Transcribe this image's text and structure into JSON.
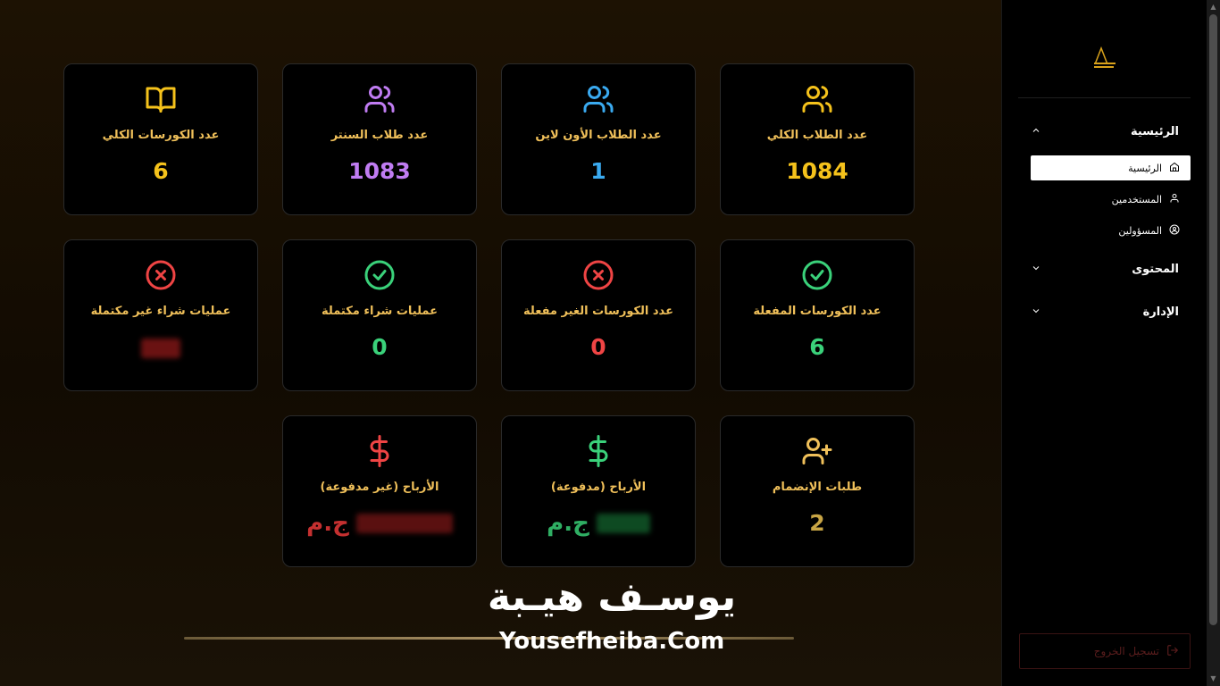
{
  "stats": [
    {
      "label": "عدد الكورسات الكلي",
      "value": "6",
      "color": "#f5c21b",
      "icon": "book-icon"
    },
    {
      "label": "عدد طلاب السنتر",
      "value": "1083",
      "color": "#c07cf2",
      "icon": "users-icon"
    },
    {
      "label": "عدد الطلاب الأون لاين",
      "value": "1",
      "color": "#3aaaf0",
      "icon": "users-icon"
    },
    {
      "label": "عدد الطلاب الكلي",
      "value": "1084",
      "color": "#f5c21b",
      "icon": "users-icon"
    },
    {
      "label": "عمليات شراء غير مكتملة",
      "value": "",
      "color": "#ef4444",
      "icon": "x-circle-icon"
    },
    {
      "label": "عمليات شراء مكتملة",
      "value": "0",
      "color": "#3ad17a",
      "icon": "check-circle-icon"
    },
    {
      "label": "عدد الكورسات الغير مفعلة",
      "value": "0",
      "color": "#ef4444",
      "icon": "x-circle-icon"
    },
    {
      "label": "عدد الكورسات المفعلة",
      "value": "6",
      "color": "#3ad17a",
      "icon": "check-circle-icon"
    },
    {
      "label": "الأرباح (غير مدفوعة)",
      "value": "",
      "currency": "ج.م",
      "color": "#ef4444",
      "icon": "dollar-icon"
    },
    {
      "label": "الأرباح (مدفوعة)",
      "value": "",
      "currency": "ج.م",
      "color": "#3ad17a",
      "icon": "dollar-icon"
    },
    {
      "label": "طلبات الإنضمام",
      "value": "2",
      "color": "#c8a545",
      "icon": "user-plus-icon"
    }
  ],
  "sidebar": {
    "groups": [
      {
        "label": "الرئيسية",
        "expanded": true,
        "items": [
          {
            "label": "الرئيسية",
            "icon": "home-icon",
            "active": true
          },
          {
            "label": "المستخدمين",
            "icon": "user-icon",
            "active": false
          },
          {
            "label": "المسؤولين",
            "icon": "user-circle-icon",
            "active": false
          }
        ]
      },
      {
        "label": "المحتوى",
        "expanded": false
      },
      {
        "label": "الإدارة",
        "expanded": false
      }
    ],
    "logout": "تسجيل الخروج"
  },
  "watermark": {
    "arabic": "يوسـف هيـبة",
    "english": "Yousefheiba.Com"
  }
}
